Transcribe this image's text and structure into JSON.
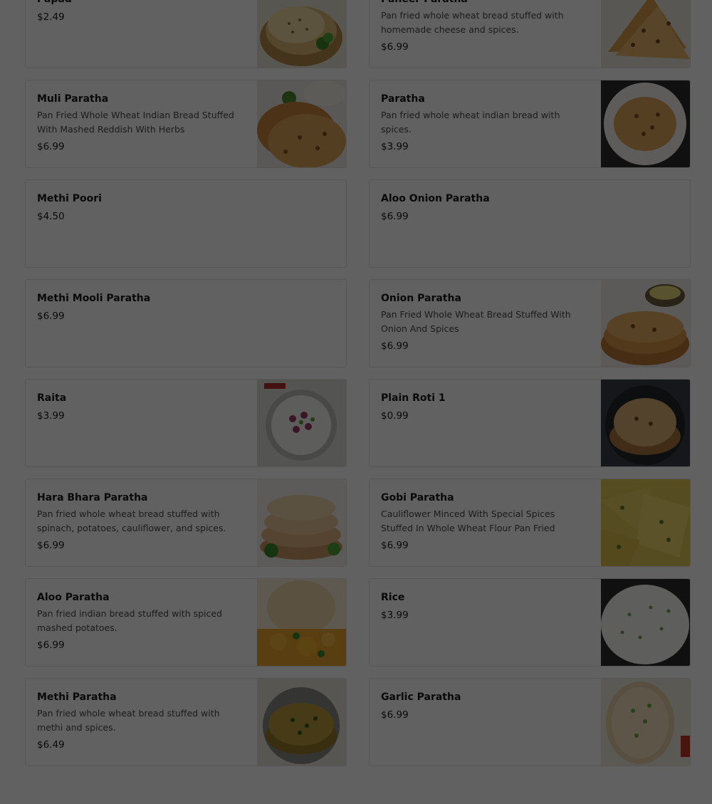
{
  "menu": {
    "items": [
      {
        "name": "Papad",
        "description": "",
        "price": "$2.49",
        "image": "papad-image"
      },
      {
        "name": "Paneer Paratha",
        "description": "Pan fried whole wheat bread stuffed with homemade cheese and spices.",
        "price": "$6.99",
        "image": "paneer-paratha-image"
      },
      {
        "name": "Muli Paratha",
        "description": "Pan Fried Whole Wheat Indian Bread Stuffed With Mashed Reddish With Herbs",
        "price": "$6.99",
        "image": "muli-paratha-image"
      },
      {
        "name": "Paratha",
        "description": "Pan fried whole wheat indian bread with spices.",
        "price": "$3.99",
        "image": "paratha-image"
      },
      {
        "name": "Methi Poori",
        "description": "",
        "price": "$4.50",
        "image": ""
      },
      {
        "name": "Aloo Onion Paratha",
        "description": "",
        "price": "$6.99",
        "image": ""
      },
      {
        "name": "Methi Mooli Paratha",
        "description": "",
        "price": "$6.99",
        "image": ""
      },
      {
        "name": "Onion Paratha",
        "description": "Pan Fried Whole Wheat Bread Stuffed With Onion And Spices",
        "price": "$6.99",
        "image": "onion-paratha-image"
      },
      {
        "name": "Raita",
        "description": "",
        "price": "$3.99",
        "image": "raita-image"
      },
      {
        "name": "Plain Roti 1",
        "description": "",
        "price": "$0.99",
        "image": "plain-roti-image"
      },
      {
        "name": "Hara Bhara Paratha",
        "description": "Pan fried whole wheat bread stuffed with spinach, potatoes, cauliflower, and spices.",
        "price": "$6.99",
        "image": "hara-bhara-paratha-image"
      },
      {
        "name": "Gobi Paratha",
        "description": "Cauliflower Minced With Special Spices Stuffed In Whole Wheat Flour Pan Fried",
        "price": "$6.99",
        "image": "gobi-paratha-image"
      },
      {
        "name": "Aloo Paratha",
        "description": "Pan fried indian bread stuffed with spiced mashed potatoes.",
        "price": "$6.99",
        "image": "aloo-paratha-image"
      },
      {
        "name": "Rice",
        "description": "",
        "price": "$3.99",
        "image": "rice-image"
      },
      {
        "name": "Methi Paratha",
        "description": "Pan fried whole wheat bread stuffed with methi and spices.",
        "price": "$6.49",
        "image": "methi-paratha-image"
      },
      {
        "name": "Garlic Paratha",
        "description": "",
        "price": "$6.99",
        "image": "garlic-paratha-image"
      }
    ]
  },
  "colors": {
    "overlay": "#000000",
    "card_border": "#e3e3e3",
    "text_primary": "#191919",
    "text_secondary": "#494949"
  }
}
